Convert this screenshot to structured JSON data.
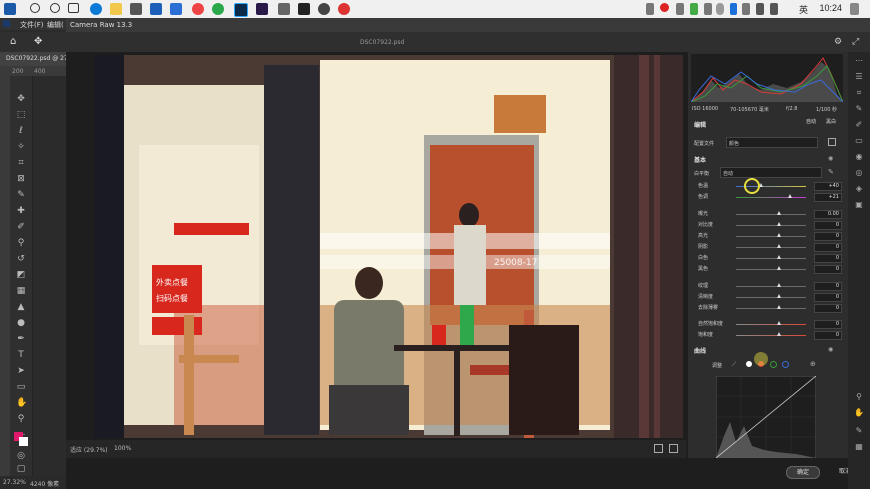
{
  "taskbar": {
    "time": "10:24",
    "lang": "英"
  },
  "ps": {
    "menu": [
      "文件(F)",
      "编辑("
    ],
    "doc_tab": "DSC07922.psd @ 27",
    "ruler": [
      "200",
      "400"
    ],
    "status": "27.32%",
    "status2": "4240 像素"
  },
  "camera_raw": {
    "title": "Camera Raw 13.3",
    "file_name": "DSC07922.psd",
    "zoom_label": "适应 (29.7%)",
    "zoom_value": "100%",
    "ok_label": "确定",
    "cancel_label": "取消"
  },
  "histogram_info": {
    "iso": "ISO 16000",
    "lens": "70-105670 毫米",
    "aperture": "f/2.8",
    "shutter": "1/100 秒"
  },
  "panel": {
    "edit_title": "编辑",
    "auto_label": "自动",
    "bw_label": "黑白",
    "profile_label": "配置文件",
    "profile_value": "颜色",
    "basic_title": "基本",
    "wb_label": "白平衡",
    "wb_value": "自动",
    "curve_title": "曲线",
    "curve_adjust": "调整",
    "sliders": [
      {
        "label": "色温",
        "value": "+40",
        "pos": 0.36
      },
      {
        "label": "色调",
        "value": "+21",
        "pos": 0.77
      },
      {
        "label": "曝光",
        "value": "0.00",
        "pos": 0.62
      },
      {
        "label": "对比度",
        "value": "0",
        "pos": 0.62
      },
      {
        "label": "高光",
        "value": "0",
        "pos": 0.62
      },
      {
        "label": "阴影",
        "value": "0",
        "pos": 0.62
      },
      {
        "label": "白色",
        "value": "0",
        "pos": 0.62
      },
      {
        "label": "黑色",
        "value": "0",
        "pos": 0.62
      },
      {
        "label": "纹理",
        "value": "0",
        "pos": 0.62
      },
      {
        "label": "清晰度",
        "value": "0",
        "pos": 0.62
      },
      {
        "label": "去除薄雾",
        "value": "0",
        "pos": 0.62
      },
      {
        "label": "自然饱和度",
        "value": "0",
        "pos": 0.62
      },
      {
        "label": "饱和度",
        "value": "0",
        "pos": 0.62
      }
    ]
  },
  "photo_signs": {
    "sign1": "外卖点餐",
    "sign2": "扫码点餐",
    "banner": "25008-17"
  },
  "colors": {
    "accent": "#3aa0ff",
    "ok_button": "#3a3a3a",
    "taskbar": "#f0f0f0"
  }
}
